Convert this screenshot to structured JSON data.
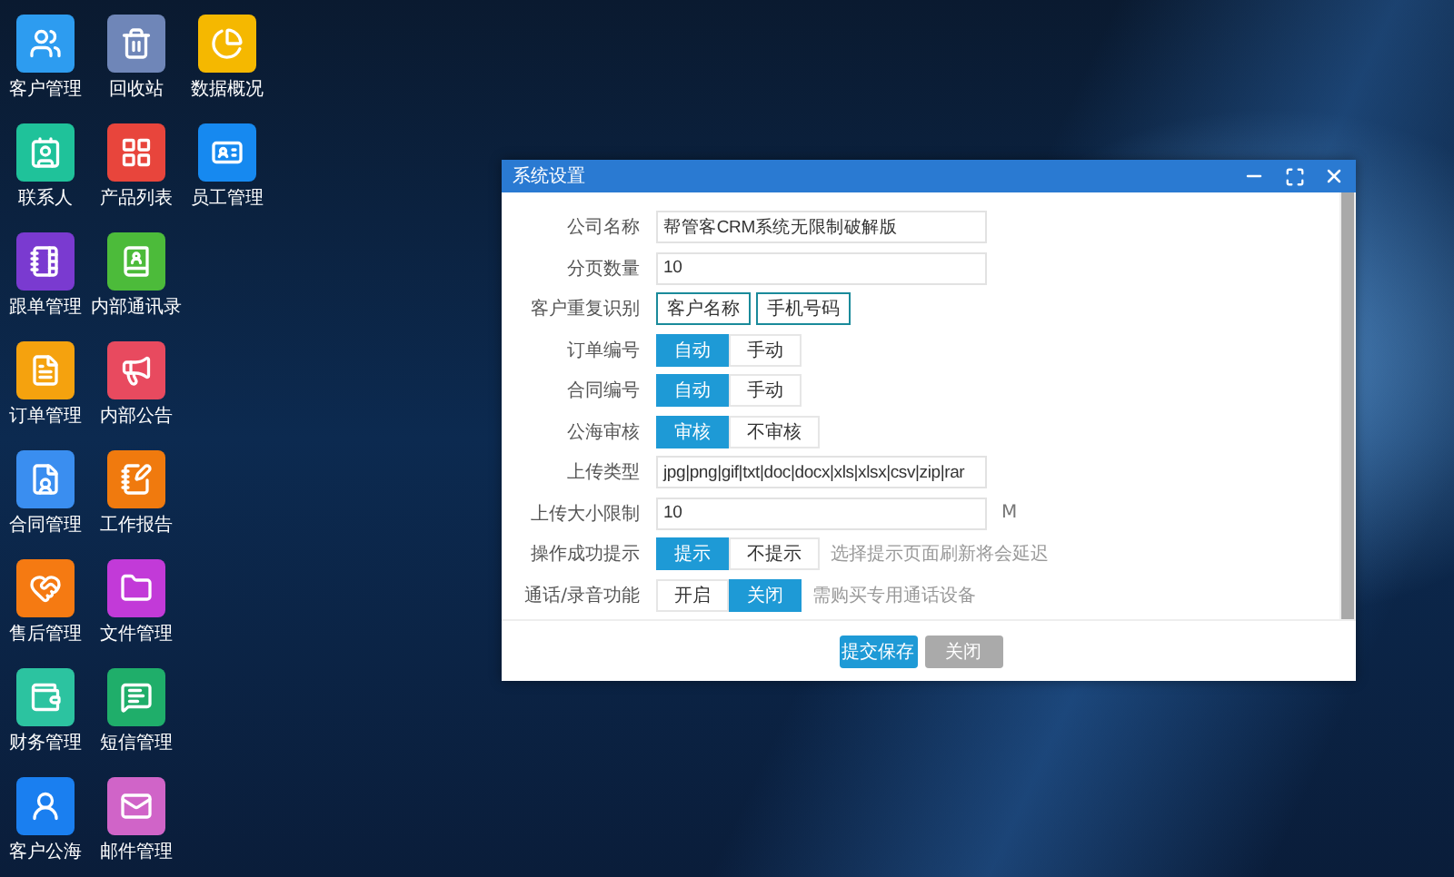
{
  "desktop_icons": [
    [
      {
        "label": "客户管理",
        "color": "#2d9cf0"
      },
      {
        "label": "回收站",
        "color": "#6f86b8"
      },
      {
        "label": "数据概况",
        "color": "#f5b800"
      }
    ],
    [
      {
        "label": "联系人",
        "color": "#1fc29a"
      },
      {
        "label": "产品列表",
        "color": "#e8453c"
      },
      {
        "label": "员工管理",
        "color": "#1689f0"
      }
    ],
    [
      {
        "label": "跟单管理",
        "color": "#7a3ad0"
      },
      {
        "label": "内部通讯录",
        "color": "#4cbb3a"
      }
    ],
    [
      {
        "label": "订单管理",
        "color": "#f5a20e"
      },
      {
        "label": "内部公告",
        "color": "#e84a5f"
      }
    ],
    [
      {
        "label": "合同管理",
        "color": "#3a8ef0"
      },
      {
        "label": "工作报告",
        "color": "#f07a0e"
      }
    ],
    [
      {
        "label": "售后管理",
        "color": "#f57a12"
      },
      {
        "label": "文件管理",
        "color": "#c23ad8"
      }
    ],
    [
      {
        "label": "财务管理",
        "color": "#2cc3a0"
      },
      {
        "label": "短信管理",
        "color": "#1fae6a"
      }
    ],
    [
      {
        "label": "客户公海",
        "color": "#1a7ff0"
      },
      {
        "label": "邮件管理",
        "color": "#d064c8"
      }
    ]
  ],
  "dialog": {
    "title": "系统设置",
    "rows": [
      {
        "kind": "text",
        "label": "公司名称",
        "value": "帮管客CRM系统无限制破解版"
      },
      {
        "kind": "text",
        "label": "分页数量",
        "value": "10"
      },
      {
        "kind": "tags",
        "label": "客户重复识别",
        "tags": [
          "客户名称",
          "手机号码"
        ]
      },
      {
        "kind": "choice",
        "label": "订单编号",
        "options": [
          {
            "label": "自动",
            "selected": true
          },
          {
            "label": "手动",
            "selected": false
          }
        ]
      },
      {
        "kind": "choice",
        "label": "合同编号",
        "options": [
          {
            "label": "自动",
            "selected": true
          },
          {
            "label": "手动",
            "selected": false
          }
        ]
      },
      {
        "kind": "choice",
        "label": "公海审核",
        "options": [
          {
            "label": "审核",
            "selected": true
          },
          {
            "label": "不审核",
            "selected": false
          }
        ]
      },
      {
        "kind": "text",
        "label": "上传类型",
        "value": "jpg|png|gif|txt|doc|docx|xls|xlsx|csv|zip|rar"
      },
      {
        "kind": "text",
        "label": "上传大小限制",
        "value": "10",
        "suffix": "M"
      },
      {
        "kind": "choice",
        "label": "操作成功提示",
        "options": [
          {
            "label": "提示",
            "selected": true
          },
          {
            "label": "不提示",
            "selected": false
          }
        ],
        "hint": "选择提示页面刷新将会延迟"
      },
      {
        "kind": "choice",
        "label": "通话/录音功能",
        "options": [
          {
            "label": "开启",
            "selected": false
          },
          {
            "label": "关闭",
            "selected": true
          }
        ],
        "hint": "需购买专用通话设备"
      }
    ],
    "buttons": [
      {
        "label": "提交保存",
        "kind": "primary"
      },
      {
        "label": "关闭",
        "kind": "secondary"
      }
    ]
  }
}
